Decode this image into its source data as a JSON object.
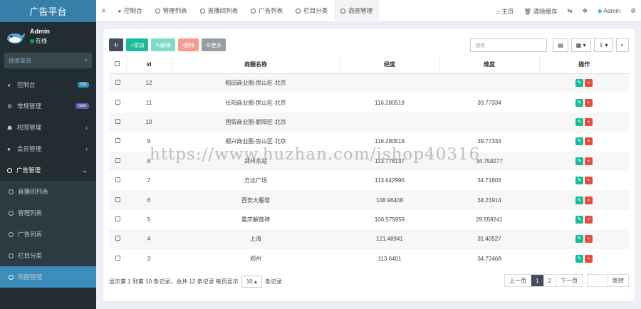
{
  "app": {
    "title": "广告平台"
  },
  "user": {
    "name": "Admin",
    "status": "在线"
  },
  "sidebar": {
    "search_placeholder": "搜索菜单",
    "items": [
      {
        "label": "控制台",
        "icon": "dashboard-icon",
        "badge": "hot",
        "badge_color": "#3c8dbc"
      },
      {
        "label": "常规管理",
        "icon": "cogs-icon",
        "badge": "new",
        "badge_color": "#605ca8"
      },
      {
        "label": "权限管理",
        "icon": "group-icon"
      },
      {
        "label": "会员管理",
        "icon": "user-circle-icon"
      },
      {
        "label": "广告管理",
        "icon": "circle-icon"
      }
    ],
    "sub_items": [
      {
        "label": "直播间列表"
      },
      {
        "label": "管理列表"
      },
      {
        "label": "广告列表"
      },
      {
        "label": "栏目分类"
      },
      {
        "label": "商圈管理",
        "active": true
      }
    ]
  },
  "topbar": {
    "tabs": [
      {
        "label": "控制台",
        "icon": "dashboard-icon"
      },
      {
        "label": "管理列表",
        "icon": "circle-icon"
      },
      {
        "label": "直播间列表",
        "icon": "circle-icon"
      },
      {
        "label": "广告列表",
        "icon": "circle-icon"
      },
      {
        "label": "栏目分类",
        "icon": "circle-icon"
      },
      {
        "label": "商圈管理",
        "icon": "circle-icon",
        "active": true
      }
    ],
    "home": "主页",
    "clear_cache": "清除缓存",
    "user": "Admin"
  },
  "toolbar": {
    "add": "添加",
    "edit": "编辑",
    "delete": "删除",
    "more": "更多",
    "search_placeholder": "搜索"
  },
  "table": {
    "headers": [
      "id",
      "商圈名称",
      "经度",
      "维度",
      "操作"
    ],
    "rows": [
      {
        "id": "12",
        "name": "稻田商业圈-房山区-北京",
        "lng": "",
        "lat": ""
      },
      {
        "id": "11",
        "name": "长阳商业圈-房山区-北京",
        "lng": "116.280519",
        "lat": "39.77334"
      },
      {
        "id": "10",
        "name": "国贸商业圈-朝阳区-北京",
        "lng": "",
        "lat": ""
      },
      {
        "id": "9",
        "name": "顺兴商业圈-房山区-北京",
        "lng": "116.280519",
        "lat": "39.77334"
      },
      {
        "id": "8",
        "name": "郑州东站",
        "lng": "113.778137",
        "lat": "34.759277"
      },
      {
        "id": "7",
        "name": "万达广场",
        "lng": "113.642996",
        "lat": "34.71803"
      },
      {
        "id": "6",
        "name": "西安大雁塔",
        "lng": "108.96408",
        "lat": "34.21914"
      },
      {
        "id": "5",
        "name": "重庆解放碑",
        "lng": "106.575959",
        "lat": "29.559241"
      },
      {
        "id": "4",
        "name": "上海",
        "lng": "121.48941",
        "lat": "31.40527"
      },
      {
        "id": "3",
        "name": "郑州",
        "lng": "113.6401",
        "lat": "34.72468"
      }
    ]
  },
  "footer": {
    "summary": "显示第 1 到第 10 条记录，总共 12 条记录 每页显示",
    "page_size": "10 ▴",
    "suffix": "条记录"
  },
  "pagination": {
    "prev": "上一页",
    "pages": [
      "1",
      "2"
    ],
    "next": "下一页",
    "go": "跳转"
  },
  "watermark": "https://www.huzhan.com/ishop40316"
}
